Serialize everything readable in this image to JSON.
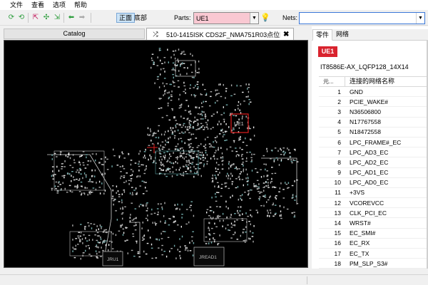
{
  "menu": [
    "文件",
    "查看",
    "选项",
    "帮助"
  ],
  "toolbar": {
    "view_front": "正面",
    "view_bottom": "底部",
    "parts_label": "Parts:",
    "parts_value": "UE1",
    "nets_label": "Nets:",
    "nets_value": ""
  },
  "tabs": {
    "catalog": "Catalog",
    "document": "510-1415ISK CDS2F_NMA751R03点位图"
  },
  "canvas_labels": {
    "highlight": "UE1",
    "jread1": "JREAD1",
    "jru1": "JRU1"
  },
  "panel": {
    "tab_parts": "零件",
    "tab_nets": "网络",
    "part_badge": "UE1",
    "package": "IT8586E-AX_LQFP128_14X14",
    "col_index": "元...",
    "col_name": "连接的网络名称",
    "rows": [
      {
        "idx": "1",
        "name": "GND"
      },
      {
        "idx": "2",
        "name": "PCIE_WAKE#"
      },
      {
        "idx": "3",
        "name": "N36506800"
      },
      {
        "idx": "4",
        "name": "N17767558"
      },
      {
        "idx": "5",
        "name": "N18472558"
      },
      {
        "idx": "6",
        "name": "LPC_FRAME#_EC"
      },
      {
        "idx": "7",
        "name": "LPC_AD3_EC"
      },
      {
        "idx": "8",
        "name": "LPC_AD2_EC"
      },
      {
        "idx": "9",
        "name": "LPC_AD1_EC"
      },
      {
        "idx": "10",
        "name": "LPC_AD0_EC"
      },
      {
        "idx": "11",
        "name": "+3VS"
      },
      {
        "idx": "12",
        "name": "VCOREVCC"
      },
      {
        "idx": "13",
        "name": "CLK_PCI_EC"
      },
      {
        "idx": "14",
        "name": "WRST#"
      },
      {
        "idx": "15",
        "name": "EC_SMI#"
      },
      {
        "idx": "16",
        "name": "EC_RX"
      },
      {
        "idx": "17",
        "name": "EC_TX"
      },
      {
        "idx": "18",
        "name": "PM_SLP_S3#"
      }
    ]
  },
  "colors": {
    "highlight": "#e01e1e",
    "parts_field": "#f9c8d2",
    "badge": "#d9232e",
    "canvas": "#000000"
  },
  "icons": [
    "refresh-icon",
    "refresh-alt-icon",
    "zoom-out-icon",
    "zoom-fit-icon",
    "zoom-in-icon",
    "arrow-back-icon",
    "arrow-forward-icon",
    "lightbulb-icon",
    "swap-icon",
    "close-icon",
    "chevron-down-icon"
  ]
}
